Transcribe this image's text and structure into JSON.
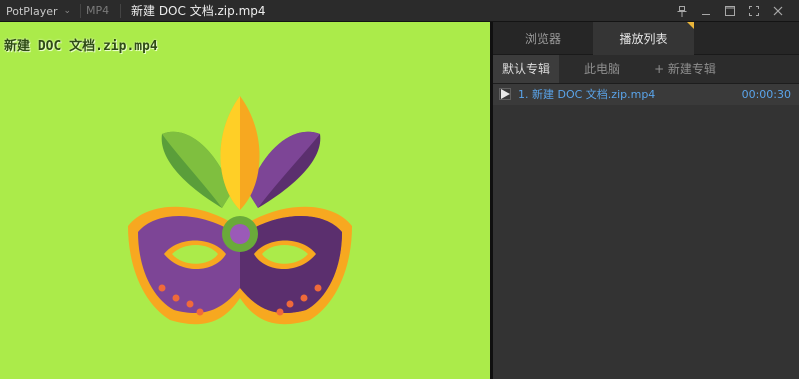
{
  "titlebar": {
    "app_menu_label": "PotPlayer",
    "format": "MP4",
    "title": "新建 DOC 文档.zip.mp4"
  },
  "video": {
    "osd_title": "新建 DOC 文档.zip.mp4",
    "background": "#abeb4a"
  },
  "panel": {
    "tabs": [
      {
        "label": "浏览器",
        "active": false
      },
      {
        "label": "播放列表",
        "active": true
      }
    ],
    "albums": [
      {
        "label": "默认专辑",
        "active": true
      },
      {
        "label": "此电脑",
        "active": false
      },
      {
        "label": "+ 新建专辑",
        "active": false
      }
    ],
    "playlist": [
      {
        "label": "1. 新建 DOC 文档.zip.mp4",
        "duration": "00:00:30",
        "playing": true
      }
    ]
  },
  "colors": {
    "accent": "#5aa4ea",
    "tab_marker": "#e9b53a"
  }
}
